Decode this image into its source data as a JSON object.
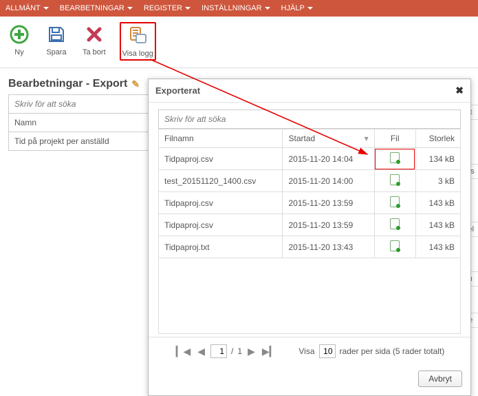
{
  "menu": {
    "items": [
      "ALLMÄNT",
      "BEARBETNINGAR",
      "REGISTER",
      "INSTÄLLNINGAR",
      "HJÄLP"
    ]
  },
  "toolbar": {
    "ny": "Ny",
    "spara": "Spara",
    "tabort": "Ta bort",
    "visalogg": "Visa logg"
  },
  "page_title": "Bearbetningar - Export",
  "left": {
    "search_placeholder": "Skriv för att söka",
    "col_namn": "Namn",
    "row1": "Tid på projekt per anställd"
  },
  "modal": {
    "title": "Exporterat",
    "search_placeholder": "Skriv för att söka",
    "columns": {
      "filnamn": "Filnamn",
      "startad": "Startad",
      "fil": "Fil",
      "storlek": "Storlek"
    },
    "rows": [
      {
        "filnamn": "Tidpaproj.csv",
        "startad": "2015-11-20 14:04",
        "storlek": "134 kB",
        "hl": true
      },
      {
        "filnamn": "test_20151120_1400.csv",
        "startad": "2015-11-20 14:00",
        "storlek": "3 kB",
        "hl": false
      },
      {
        "filnamn": "Tidpaproj.csv",
        "startad": "2015-11-20 13:59",
        "storlek": "143 kB",
        "hl": false
      },
      {
        "filnamn": "Tidpaproj.csv",
        "startad": "2015-11-20 13:59",
        "storlek": "143 kB",
        "hl": false
      },
      {
        "filnamn": "Tidpaproj.txt",
        "startad": "2015-11-20 13:43",
        "storlek": "143 kB",
        "hl": false
      }
    ],
    "pager": {
      "page": "1",
      "total": "1",
      "visa_label": "Visa",
      "per_page": "10",
      "suffix": "rader per sida (5 rader totalt)"
    },
    "cancel": "Avbryt"
  },
  "right_fragments": [
    "nst",
    "ans",
    "ojel",
    "ktu",
    "tue"
  ],
  "exportera_frag": "Exportera"
}
